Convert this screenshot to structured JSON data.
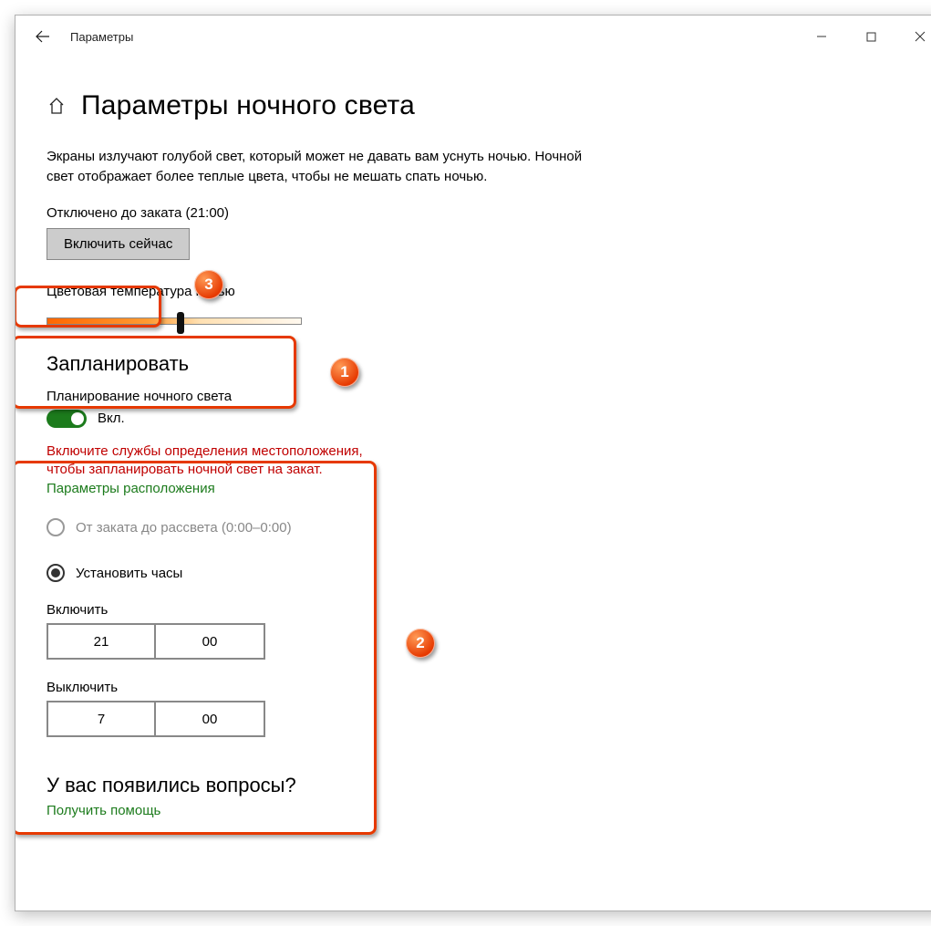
{
  "window": {
    "title": "Параметры"
  },
  "page": {
    "heading": "Параметры ночного света",
    "description": "Экраны излучают голубой свет, который может не давать вам уснуть ночью. Ночной свет отображает более теплые цвета, чтобы не мешать спать ночью.",
    "status_line": "Отключено до заката (21:00)",
    "turn_on_button": "Включить сейчас"
  },
  "color_temp": {
    "label": "Цветовая температура ночью",
    "slider_percent": 52
  },
  "schedule": {
    "heading": "Запланировать",
    "toggle_label_title": "Планирование ночного света",
    "toggle_state_label": "Вкл.",
    "toggle_on": true,
    "warning": "Включите службы определения местоположения, чтобы запланировать ночной свет на закат.",
    "location_link": "Параметры расположения",
    "radio_sunset_label": "От заката до рассвета (0:00–0:00)",
    "radio_sunset_enabled": false,
    "radio_hours_label": "Установить часы",
    "radio_hours_selected": true,
    "turn_on_label": "Включить",
    "turn_on_hour": "21",
    "turn_on_minute": "00",
    "turn_off_label": "Выключить",
    "turn_off_hour": "7",
    "turn_off_minute": "00"
  },
  "help": {
    "heading": "У вас появились вопросы?",
    "link": "Получить помощь"
  },
  "annotations": {
    "b1": "1",
    "b2": "2",
    "b3": "3"
  }
}
